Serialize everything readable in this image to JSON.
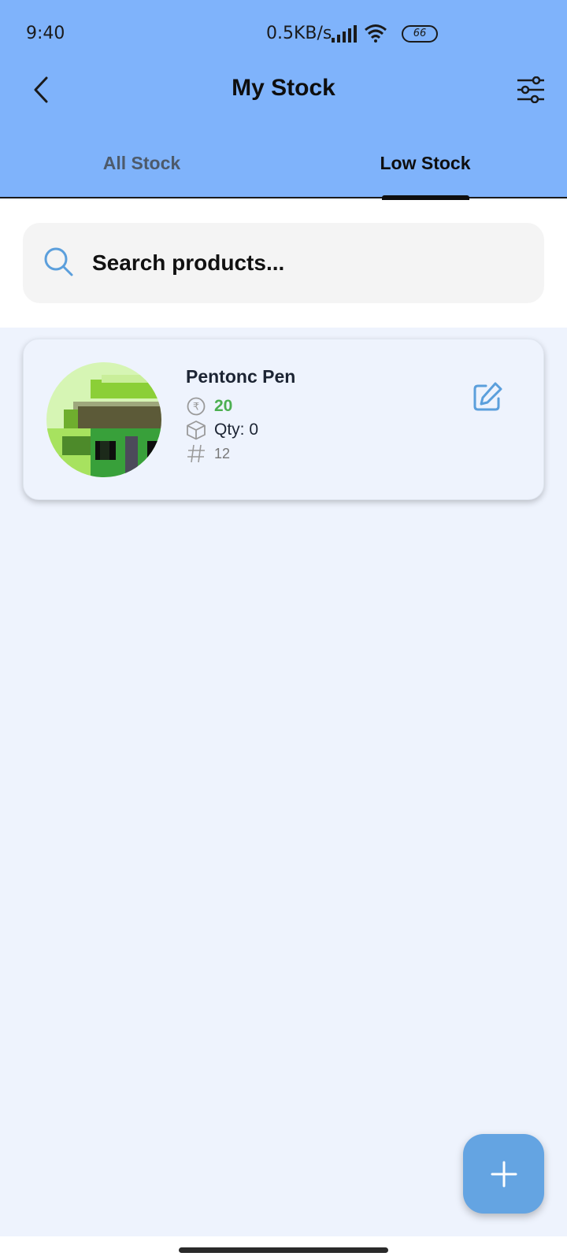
{
  "status_bar": {
    "time": "9:40",
    "net_speed": "0.5KB/s",
    "battery": "66"
  },
  "header": {
    "title": "My Stock",
    "back_icon": "chevron-left-icon",
    "filter_icon": "sliders-icon"
  },
  "tabs": [
    {
      "label": "All Stock",
      "selected": false
    },
    {
      "label": "Low Stock",
      "selected": true
    }
  ],
  "search": {
    "placeholder": "Search products..."
  },
  "products": [
    {
      "name": "Pentonc Pen",
      "price": "20",
      "quantity": "Qty: 0",
      "code": "12"
    }
  ],
  "fab": {
    "icon": "plus-icon"
  },
  "colors": {
    "header_bg": "#7fb3fb",
    "page_bg": "#eef3fd",
    "price_green": "#4caf50",
    "accent_blue": "#64a4e2"
  }
}
